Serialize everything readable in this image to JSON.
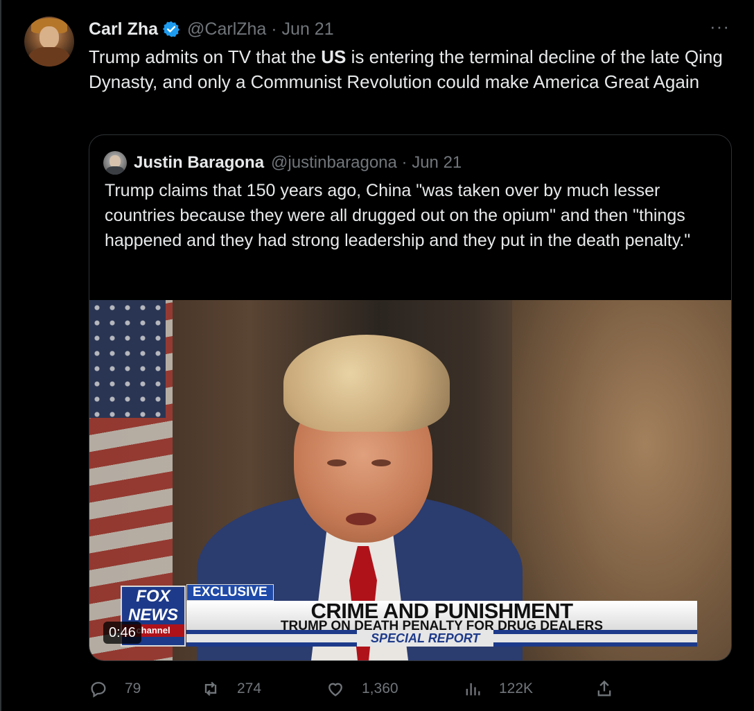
{
  "author": {
    "name": "Carl Zha",
    "handle": "@CarlZha",
    "date": "Jun 21",
    "verified": true
  },
  "tweet_text_parts": {
    "before_bold": "Trump admits on TV that the ",
    "bold": "US",
    "after_bold": " is entering the terminal decline of the late Qing Dynasty, and only a Communist Revolution could make  America Great Again"
  },
  "quoted": {
    "name": "Justin Baragona",
    "handle": "@justinbaragona",
    "date": "Jun 21",
    "text": "Trump claims that 150 years ago, China \"was taken over by much lesser countries because they were all drugged out on the opium\" and then \"things happened and they had strong leadership and they put in the death penalty.\""
  },
  "video": {
    "duration": "0:46",
    "lower_third": {
      "tag": "EXCLUSIVE",
      "title": "CRIME AND PUNISHMENT",
      "subtitle": "TRUMP ON DEATH PENALTY FOR DRUG DEALERS",
      "segment": "SPECIAL REPORT"
    },
    "logo": {
      "line1": "FOX",
      "line2": "NEWS",
      "line3": "channel"
    }
  },
  "actions": {
    "replies": "79",
    "reposts": "274",
    "likes": "1,360",
    "views": "122K"
  },
  "colors": {
    "background": "#000000",
    "text": "#e7e9ea",
    "muted": "#71767b",
    "verified_blue": "#1d9bf0",
    "border": "#2f3336"
  },
  "icons": {
    "verified": "verified-badge-icon",
    "more": "more-options-icon",
    "reply": "reply-icon",
    "repost": "repost-icon",
    "like": "heart-icon",
    "views": "views-icon",
    "share": "share-icon"
  }
}
